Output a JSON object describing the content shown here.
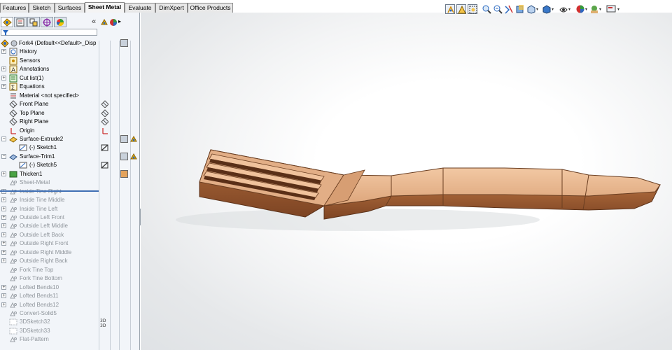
{
  "command_tabs": [
    "Features",
    "Sketch",
    "Surfaces",
    "Sheet Metal",
    "Evaluate",
    "DimXpert",
    "Office Products"
  ],
  "active_tab": "Sheet Metal",
  "panel": {
    "collapse_glyph": "«",
    "manager_tabs": [
      "feature-manager-icon",
      "property-manager-icon",
      "configuration-manager-icon",
      "dimxpert-manager-icon",
      "display-manager-icon"
    ],
    "filter_icon": "filter-icon"
  },
  "tree": {
    "root": "Fork4  (Default<<Default>_Disp",
    "items": [
      {
        "label": "History",
        "state": "normal"
      },
      {
        "label": "Sensors",
        "state": "normal"
      },
      {
        "label": "Annotations",
        "state": "normal"
      },
      {
        "label": "Cut list(1)",
        "state": "normal"
      },
      {
        "label": "Equations",
        "state": "normal"
      },
      {
        "label": "Material <not specified>",
        "state": "normal"
      },
      {
        "label": "Front Plane",
        "state": "normal"
      },
      {
        "label": "Top Plane",
        "state": "normal"
      },
      {
        "label": "Right Plane",
        "state": "normal"
      },
      {
        "label": "Origin",
        "state": "normal"
      },
      {
        "label": "Surface-Extrude2",
        "state": "normal"
      },
      {
        "label": "(-) Sketch1",
        "state": "normal"
      },
      {
        "label": "Surface-Trim1",
        "state": "normal"
      },
      {
        "label": "(-) Sketch5",
        "state": "normal"
      },
      {
        "label": "Thicken1",
        "state": "normal"
      },
      {
        "label": "Sheet-Metal",
        "state": "suppressed"
      },
      {
        "label": "Inside Tine Right",
        "state": "suppressed"
      },
      {
        "label": "Inside Tine Middle",
        "state": "suppressed"
      },
      {
        "label": "Inside Tine Left",
        "state": "suppressed"
      },
      {
        "label": "Outside Left Front",
        "state": "suppressed"
      },
      {
        "label": "Outside Left Middle",
        "state": "suppressed"
      },
      {
        "label": "Outside Left Back",
        "state": "suppressed"
      },
      {
        "label": "Outside Right Front",
        "state": "suppressed"
      },
      {
        "label": "Outside Right Middle",
        "state": "suppressed"
      },
      {
        "label": "Outside Right Back",
        "state": "suppressed"
      },
      {
        "label": "Fork Tine Top",
        "state": "suppressed"
      },
      {
        "label": "Fork Tine Bottom",
        "state": "suppressed"
      },
      {
        "label": "Lofted Bends10",
        "state": "suppressed"
      },
      {
        "label": "Lofted Bends11",
        "state": "suppressed"
      },
      {
        "label": "Lofted Bends12",
        "state": "suppressed"
      },
      {
        "label": "Convert-Solid5",
        "state": "suppressed"
      },
      {
        "label": "3DSketch32",
        "state": "suppressed"
      },
      {
        "label": "3DSketch33",
        "state": "suppressed"
      },
      {
        "label": "Flat-Pattern",
        "state": "suppressed"
      }
    ]
  },
  "heads_up_toolbar": [
    "orientation-icon",
    "zoom-to-fit-icon",
    "zoom-to-area-icon",
    "previous-view-icon",
    "section-view-icon",
    "view-orientation-icon",
    "display-style-icon",
    "hide-show-items-icon",
    "edit-appearance-icon",
    "apply-scene-icon",
    "view-settings-icon"
  ],
  "colors": {
    "panel_bg": "#f2f5f9",
    "suppressed_text": "#8f959b",
    "rollback_bar": "#3f6fb4",
    "model_body": "#d49a6e",
    "model_edge": "#6a3e21"
  }
}
